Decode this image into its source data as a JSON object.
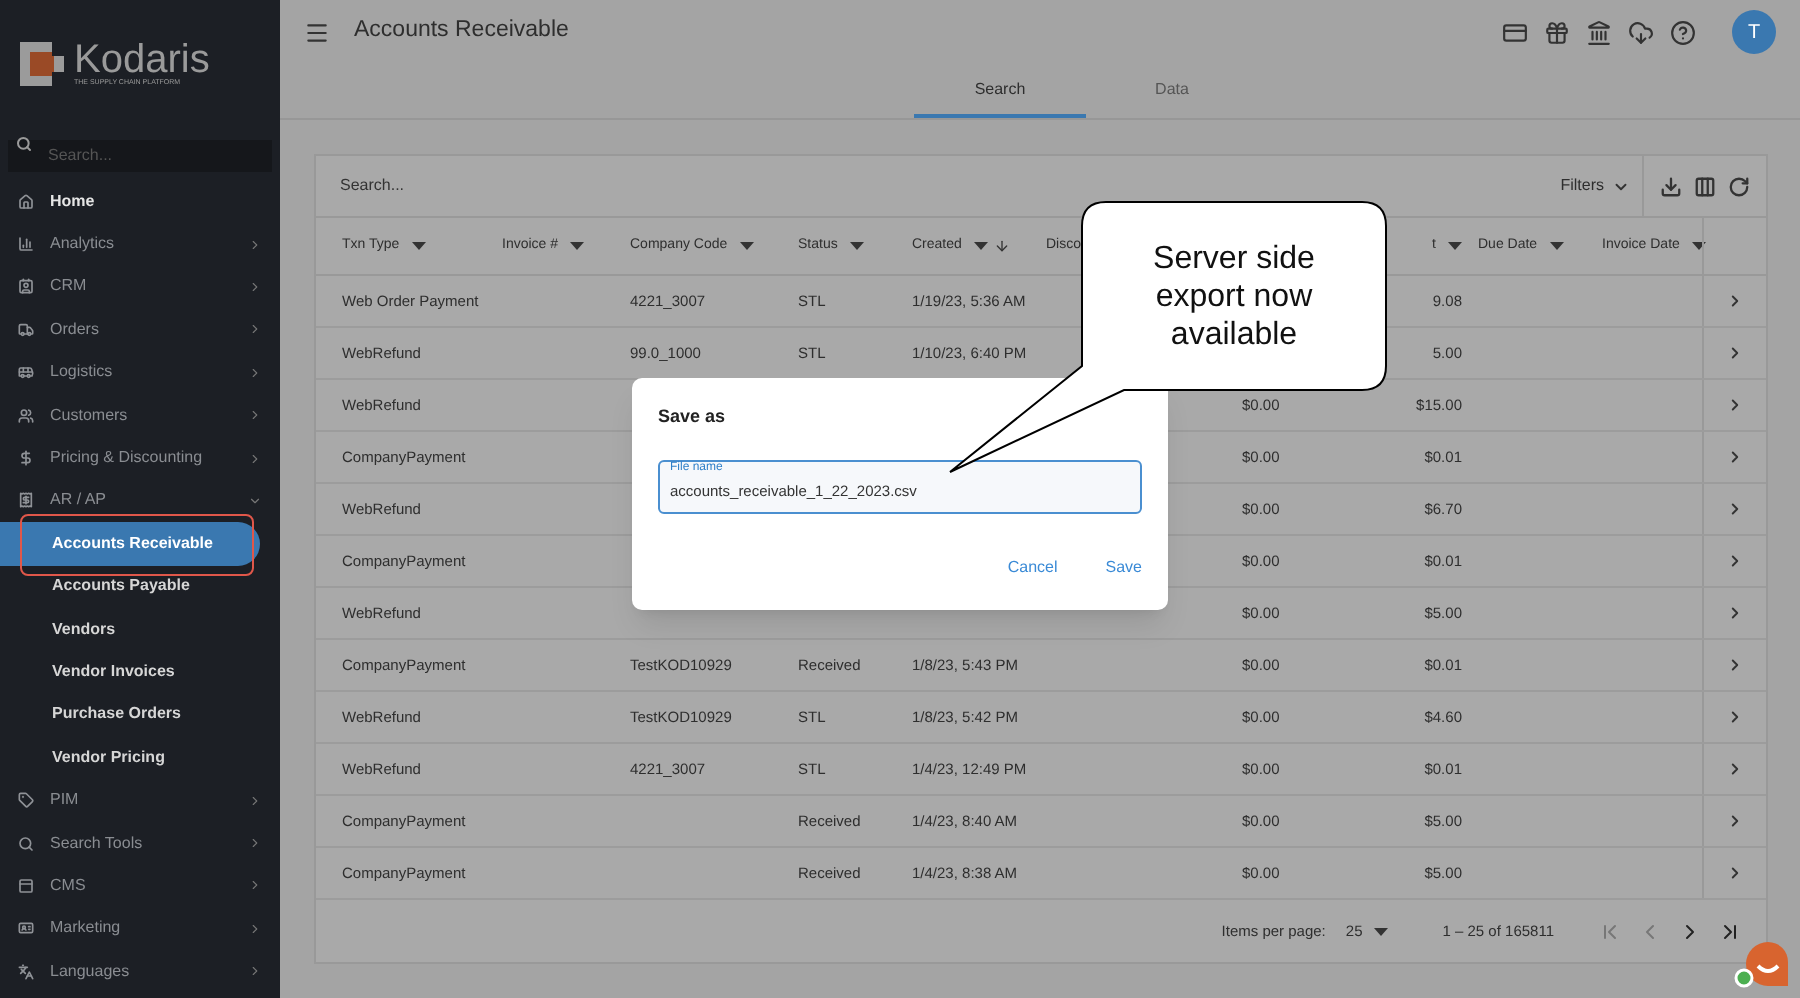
{
  "sidebar": {
    "logo": {
      "name": "Kodaris",
      "tagline": "THE SUPPLY CHAIN PLATFORM"
    },
    "search": {
      "placeholder": "Search..."
    },
    "items": [
      {
        "label": "Home",
        "kind": "link"
      },
      {
        "label": "Analytics",
        "kind": "group",
        "expanded": false
      },
      {
        "label": "CRM",
        "kind": "group",
        "expanded": false
      },
      {
        "label": "Orders",
        "kind": "group",
        "expanded": false
      },
      {
        "label": "Logistics",
        "kind": "group",
        "expanded": false
      },
      {
        "label": "Customers",
        "kind": "group",
        "expanded": false
      },
      {
        "label": "Pricing & Discounting",
        "kind": "group",
        "expanded": false
      },
      {
        "label": "AR / AP",
        "kind": "group",
        "expanded": true,
        "children": [
          {
            "label": "Accounts Receivable",
            "selected": true
          },
          {
            "label": "Accounts Payable",
            "selected": false
          },
          {
            "label": "Vendors",
            "selected": false
          },
          {
            "label": "Vendor Invoices",
            "selected": false
          },
          {
            "label": "Purchase Orders",
            "selected": false
          },
          {
            "label": "Vendor Pricing",
            "selected": false
          }
        ]
      },
      {
        "label": "PIM",
        "kind": "group",
        "expanded": false
      },
      {
        "label": "Search Tools",
        "kind": "group",
        "expanded": false
      },
      {
        "label": "CMS",
        "kind": "group",
        "expanded": false
      },
      {
        "label": "Marketing",
        "kind": "group",
        "expanded": false
      },
      {
        "label": "Languages",
        "kind": "group",
        "expanded": false
      }
    ]
  },
  "header": {
    "title": "Accounts Receivable",
    "avatar": "T"
  },
  "tabs": [
    {
      "label": "Search",
      "selected": true
    },
    {
      "label": "Data",
      "selected": false
    }
  ],
  "table": {
    "search_placeholder": "Search...",
    "filters": "Filters",
    "columns": [
      {
        "label": "Txn Type",
        "sorted": false,
        "dropdown": true
      },
      {
        "label": "Invoice #",
        "sorted": false,
        "dropdown": true
      },
      {
        "label": "Company Code",
        "sorted": false,
        "dropdown": true
      },
      {
        "label": "Status",
        "sorted": false,
        "dropdown": true
      },
      {
        "label": "Created",
        "sorted": true,
        "dropdown": true
      },
      {
        "label": "Disco",
        "sorted": false,
        "dropdown": false
      },
      null,
      {
        "label": "t",
        "sorted": false,
        "dropdown": true
      },
      {
        "label": "Due Date",
        "sorted": false,
        "dropdown": true
      },
      {
        "label": "Invoice Date",
        "sorted": false,
        "dropdown": true
      }
    ],
    "rows": [
      [
        "Web Order Payment",
        null,
        "4221_3007",
        "STL",
        "1/19/23, 5:36 AM",
        null,
        null,
        "9.08",
        null,
        null
      ],
      [
        "WebRefund",
        null,
        "99.0_1000",
        "STL",
        "1/10/23, 6:40 PM",
        null,
        null,
        "5.00",
        null,
        null
      ],
      [
        "WebRefund",
        null,
        null,
        null,
        null,
        null,
        "$0.00",
        "$15.00",
        null,
        null
      ],
      [
        "CompanyPayment",
        null,
        null,
        null,
        null,
        null,
        "$0.00",
        "$0.01",
        null,
        null
      ],
      [
        "WebRefund",
        null,
        null,
        null,
        null,
        null,
        "$0.00",
        "$6.70",
        null,
        null
      ],
      [
        "CompanyPayment",
        null,
        null,
        null,
        null,
        null,
        "$0.00",
        "$0.01",
        null,
        null
      ],
      [
        "WebRefund",
        null,
        null,
        null,
        null,
        null,
        "$0.00",
        "$5.00",
        null,
        null
      ],
      [
        "CompanyPayment",
        null,
        "TestKOD10929",
        "Received",
        "1/8/23, 5:43 PM",
        null,
        "$0.00",
        "$0.01",
        null,
        null
      ],
      [
        "WebRefund",
        null,
        "TestKOD10929",
        "STL",
        "1/8/23, 5:42 PM",
        null,
        "$0.00",
        "$4.60",
        null,
        null
      ],
      [
        "WebRefund",
        null,
        "4221_3007",
        "STL",
        "1/4/23, 12:49 PM",
        null,
        "$0.00",
        "$0.01",
        null,
        null
      ],
      [
        "CompanyPayment",
        null,
        null,
        "Received",
        "1/4/23, 8:40 AM",
        null,
        "$0.00",
        "$5.00",
        null,
        null
      ],
      [
        "CompanyPayment",
        null,
        null,
        "Received",
        "1/4/23, 8:38 AM",
        null,
        "$0.00",
        "$5.00",
        null,
        null
      ]
    ],
    "pagination": {
      "label": "Items per page:",
      "page_size": "25",
      "range": "1 – 25 of 165811"
    }
  },
  "dialog": {
    "title": "Save as",
    "field_label": "File name",
    "value": "accounts_receivable_1_22_2023.csv",
    "buttons": [
      "Cancel",
      "Save"
    ]
  },
  "callout": {
    "text": "Server side export now available"
  }
}
